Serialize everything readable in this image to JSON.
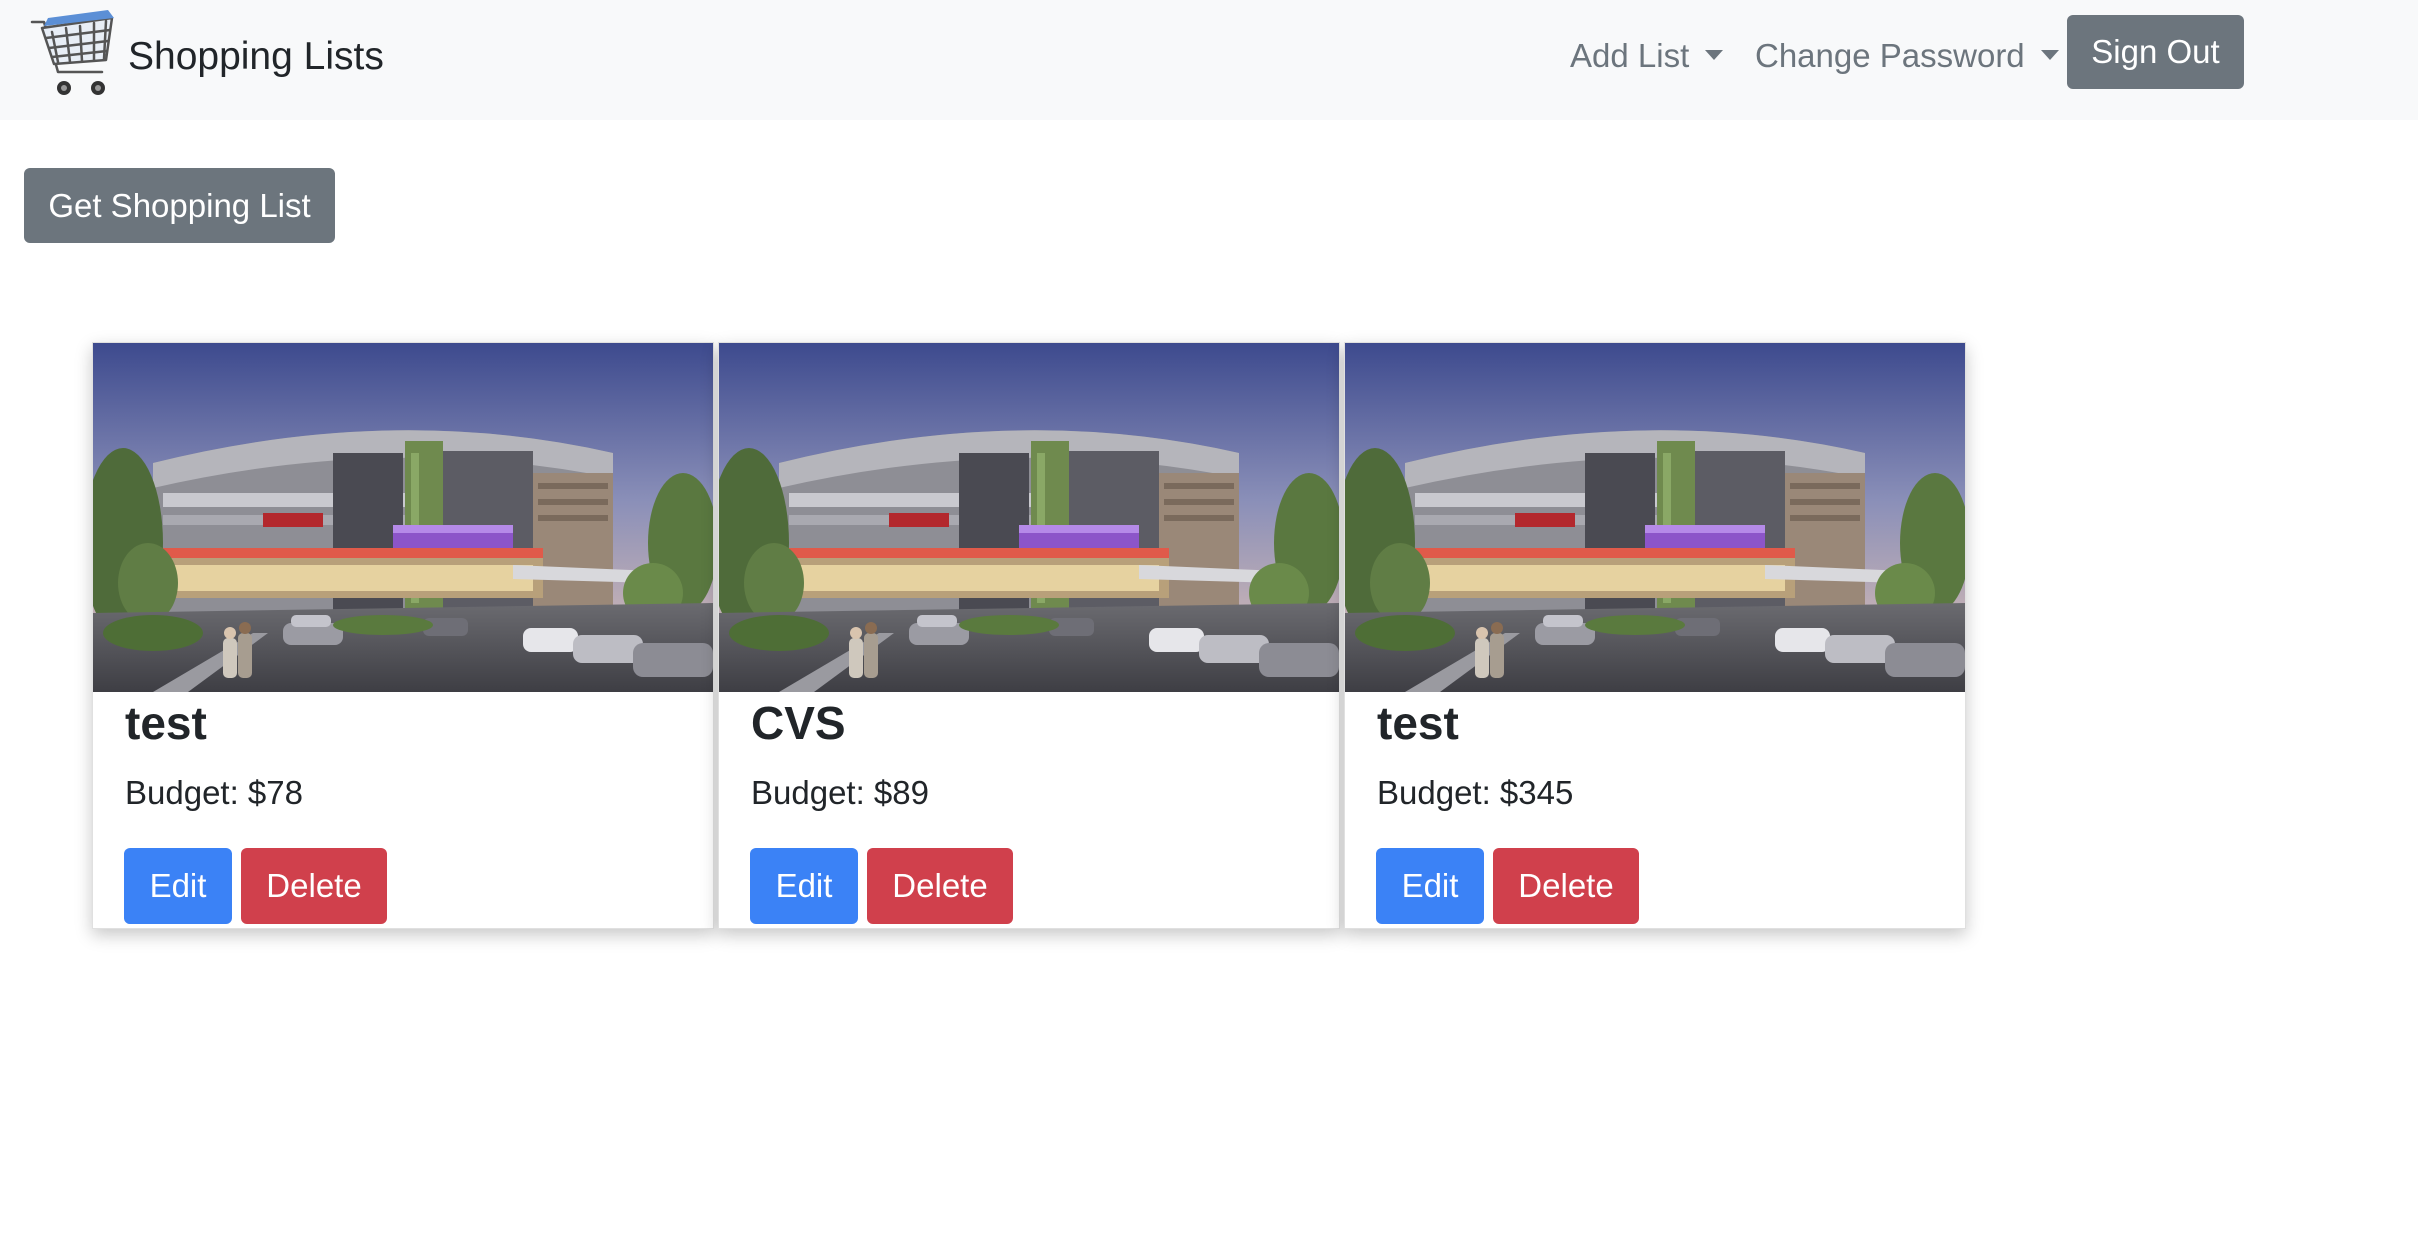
{
  "navbar": {
    "brand": "Shopping Lists",
    "add_list": "Add List",
    "change_password": "Change Password",
    "sign_out": "Sign Out"
  },
  "actions": {
    "get_list": "Get Shopping List"
  },
  "cards": [
    {
      "title": "test",
      "budget": "Budget: $78",
      "edit": "Edit",
      "delete": "Delete"
    },
    {
      "title": "CVS",
      "budget": "Budget: $89",
      "edit": "Edit",
      "delete": "Delete"
    },
    {
      "title": "test",
      "budget": "Budget: $345",
      "edit": "Edit",
      "delete": "Delete"
    }
  ],
  "colors": {
    "navbar_bg": "#f8f9fa",
    "secondary": "#6c757d",
    "primary": "#3b82f6",
    "danger": "#d0404c"
  }
}
